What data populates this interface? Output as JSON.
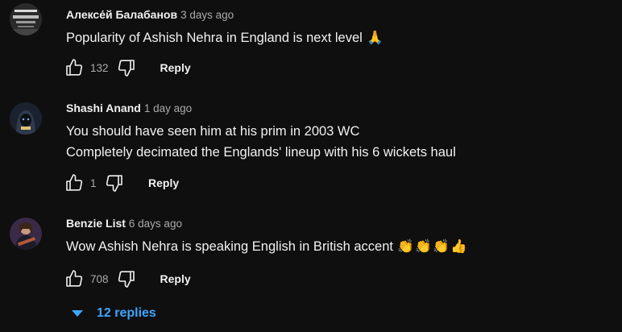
{
  "comments": [
    {
      "author": "Алексе́й Балабанов",
      "time": "3 days ago",
      "lines": [
        "Popularity of Ashish Nehra in England is next level"
      ],
      "emojis": [
        "🙏"
      ],
      "likes": "132",
      "reply_label": "Reply",
      "avatar_icon": "avatar-photo-bw-text"
    },
    {
      "author": "Shashi Anand",
      "time": "1 day ago",
      "lines": [
        "You should have seen him at his prim in 2003 WC",
        "Completely decimated the Englands' lineup with his 6 wickets haul"
      ],
      "emojis": [],
      "likes": "1",
      "reply_label": "Reply",
      "avatar_icon": "avatar-photo-hooded"
    },
    {
      "author": "Benzie List",
      "time": "6 days ago",
      "lines": [
        "Wow Ashish Nehra is speaking English in British accent"
      ],
      "emojis": [
        "👏",
        "👏",
        "👏",
        "👍"
      ],
      "likes": "708",
      "reply_label": "Reply",
      "avatar_icon": "avatar-photo-guitar"
    }
  ],
  "replies_toggle": {
    "label": "12 replies",
    "color": "#3ea6ff"
  },
  "colors": {
    "background": "#0f0f0f",
    "text": "#f1f1f1",
    "secondary": "#aaaaaa",
    "link": "#3ea6ff"
  }
}
